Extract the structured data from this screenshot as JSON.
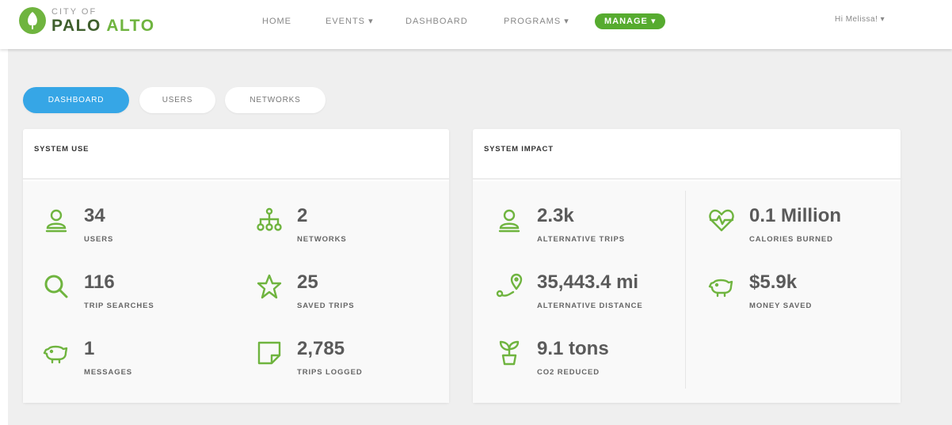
{
  "brand": {
    "city_of": "CITY OF",
    "name_part1": "PALO ",
    "name_part2": "ALTO"
  },
  "nav": {
    "home": "HOME",
    "events": "EVENTS ▾",
    "dashboard": "DASHBOARD",
    "programs": "PROGRAMS ▾",
    "manage": "MANAGE ▾"
  },
  "user_menu": {
    "greeting": "Hi Melissa! ▾"
  },
  "tabs": {
    "dashboard": "DASHBOARD",
    "users": "USERS",
    "networks": "NETWORKS"
  },
  "system_use": {
    "title": "SYSTEM USE",
    "stats": [
      {
        "value": "34",
        "label": "USERS",
        "icon": "user-icon"
      },
      {
        "value": "2",
        "label": "NETWORKS",
        "icon": "network-icon"
      },
      {
        "value": "116",
        "label": "TRIP SEARCHES",
        "icon": "search-icon"
      },
      {
        "value": "25",
        "label": "SAVED TRIPS",
        "icon": "star-icon"
      },
      {
        "value": "1",
        "label": "MESSAGES",
        "icon": "piggy-bank-icon"
      },
      {
        "value": "2,785",
        "label": "TRIPS LOGGED",
        "icon": "note-icon"
      }
    ]
  },
  "system_impact": {
    "title": "SYSTEM IMPACT",
    "stats": [
      {
        "value": "2.3k",
        "label": "ALTERNATIVE TRIPS",
        "icon": "user-icon"
      },
      {
        "value": "0.1 Million",
        "label": "CALORIES BURNED",
        "icon": "heartbeat-icon"
      },
      {
        "value": "35,443.4 mi",
        "label": "ALTERNATIVE DISTANCE",
        "icon": "route-icon"
      },
      {
        "value": "$5.9k",
        "label": "MONEY SAVED",
        "icon": "piggy-bank-icon"
      },
      {
        "value": "9.1 tons",
        "label": "CO2 REDUCED",
        "icon": "plant-icon"
      }
    ]
  },
  "colors": {
    "accent_green": "#6fb43f",
    "manage_green": "#56ab2f",
    "active_blue": "#36a6e6"
  }
}
